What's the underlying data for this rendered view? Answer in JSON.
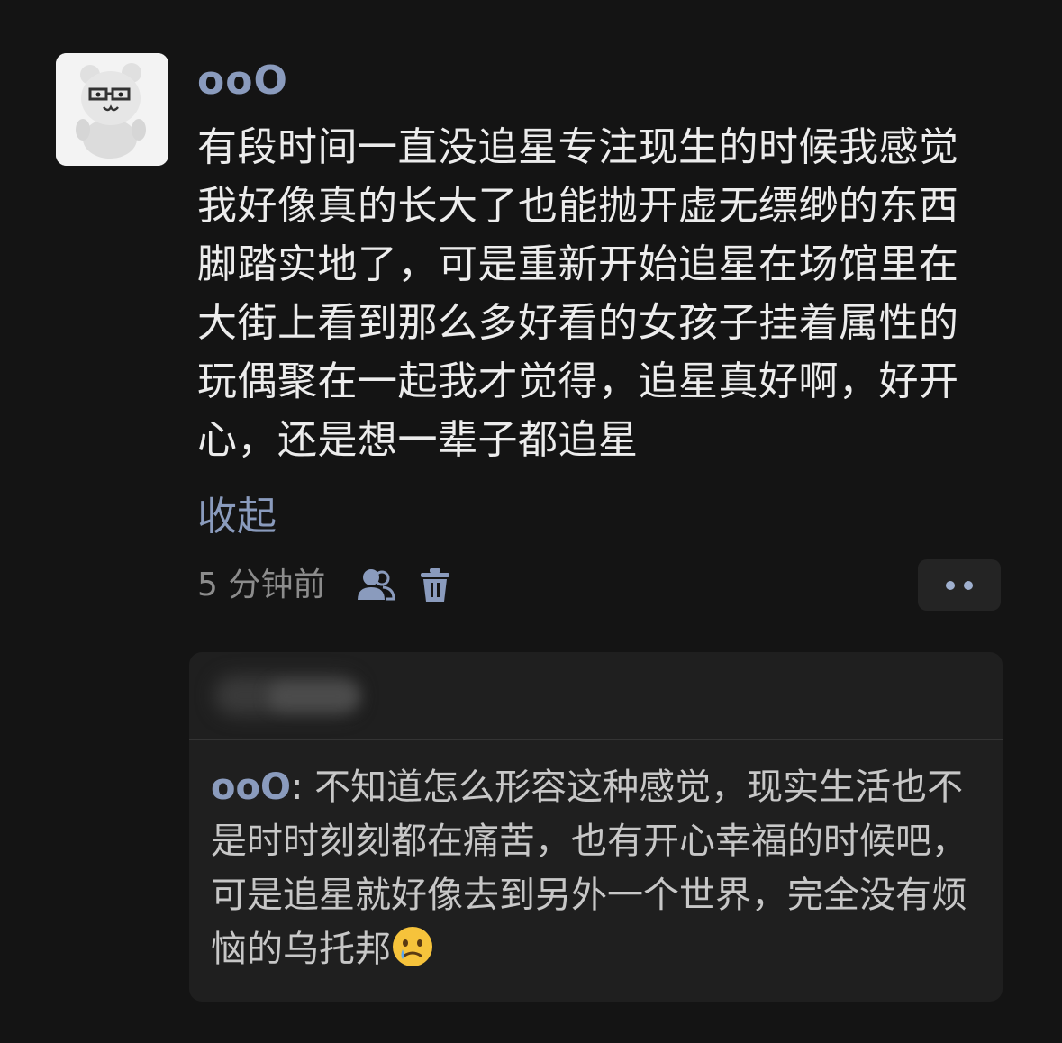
{
  "post": {
    "username": "ooO",
    "body": "有段时间一直没追星专注现生的时候我感觉我好像真的长大了也能抛开虚无缥缈的东西脚踏实地了，可是重新开始追星在场馆里在大街上看到那么多好看的女孩子挂着属性的玩偶聚在一起我才觉得，追星真好啊，好开心，还是想一辈子都追星",
    "collapse_label": "收起",
    "timestamp": "5 分钟前",
    "avatar_icon": "bear-plush-avatar",
    "visibility_icon": "people-icon",
    "delete_icon": "trash-icon"
  },
  "reply": {
    "username": "ooO",
    "separator": ": ",
    "text": "不知道怎么形容这种感觉，现实生活也不是时时刻刻都在痛苦，也有开心幸福的时候吧，可是追星就好像去到另外一个世界，完全没有烦恼的乌托邦",
    "emoji": "crying-face-emoji"
  },
  "colors": {
    "background": "#141414",
    "accent": "#8a9bbd",
    "text": "#ececec",
    "muted": "#8c8c8c",
    "card": "#1f1f1f"
  }
}
